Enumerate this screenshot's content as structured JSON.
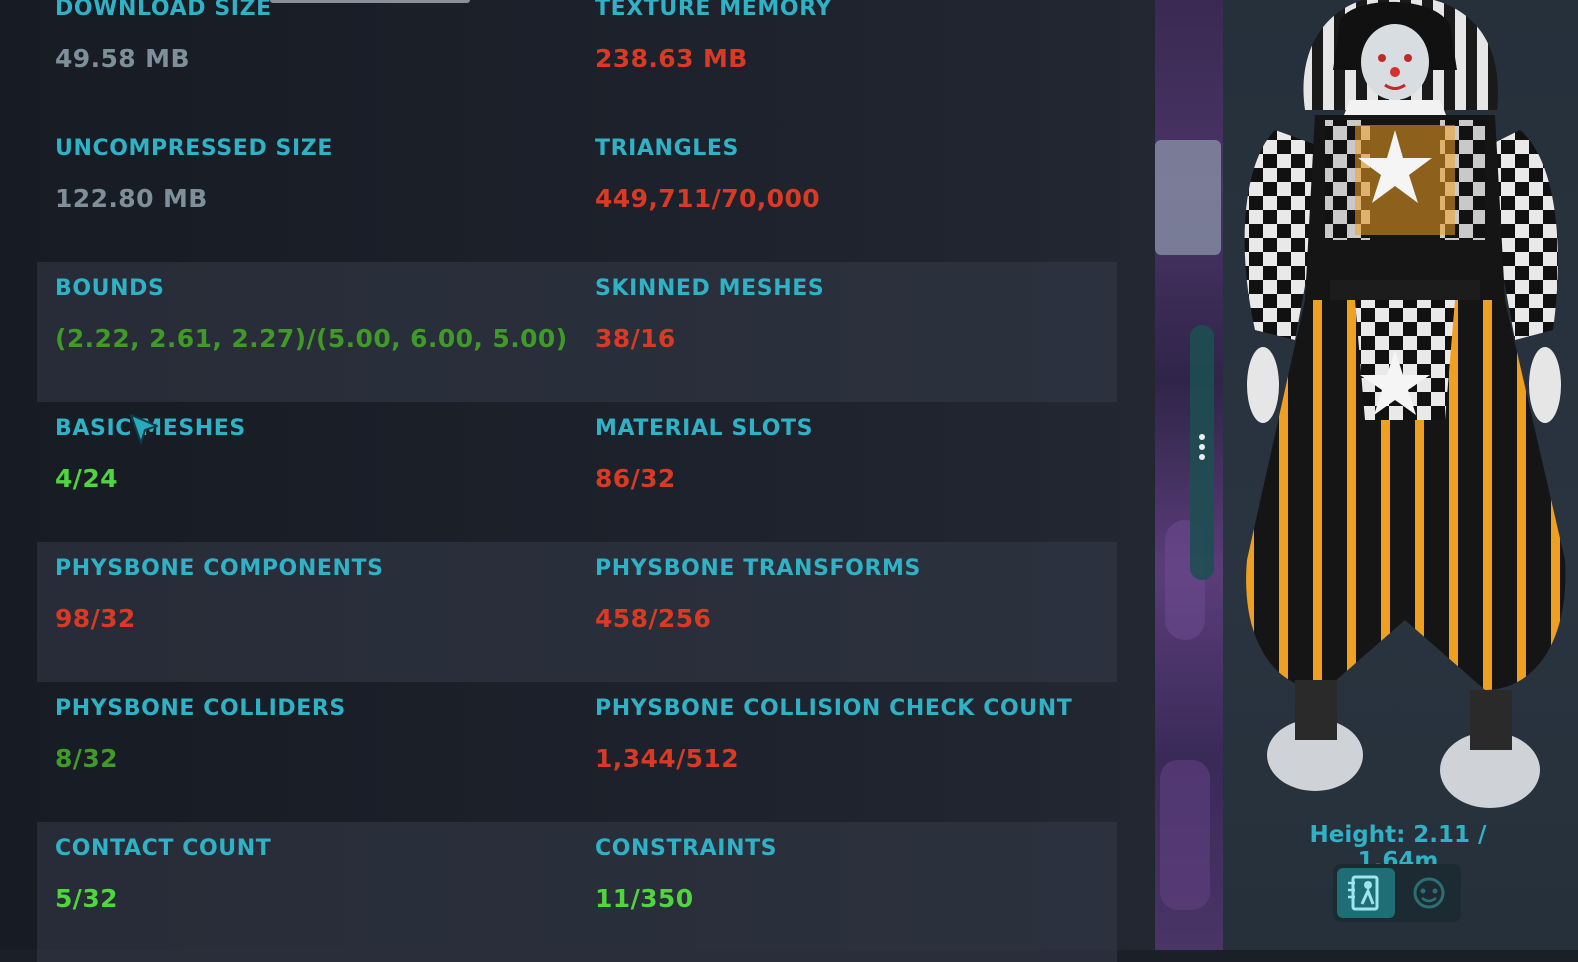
{
  "stats": [
    {
      "left": {
        "label": "DOWNLOAD SIZE",
        "value": "49.58 MB",
        "color": "#7e8f99"
      },
      "right": {
        "label": "TEXTURE MEMORY",
        "value": "238.63 MB",
        "color": "#d93a23"
      }
    },
    {
      "left": {
        "label": "UNCOMPRESSED SIZE",
        "value": "122.80 MB",
        "color": "#7e8f99"
      },
      "right": {
        "label": "TRIANGLES",
        "value": "449,711/70,000",
        "color": "#d93a23"
      }
    },
    {
      "left": {
        "label": "BOUNDS",
        "value": "(2.22, 2.61, 2.27)/(5.00, 6.00, 5.00)",
        "color": "#3f9a28"
      },
      "right": {
        "label": "SKINNED MESHES",
        "value": "38/16",
        "color": "#d93a23"
      }
    },
    {
      "left": {
        "label": "BASIC MESHES",
        "value": "4/24",
        "color": "#4fd53d"
      },
      "right": {
        "label": "MATERIAL SLOTS",
        "value": "86/32",
        "color": "#d93a23"
      }
    },
    {
      "left": {
        "label": "PHYSBONE COMPONENTS",
        "value": "98/32",
        "color": "#d93a23"
      },
      "right": {
        "label": "PHYSBONE TRANSFORMS",
        "value": "458/256",
        "color": "#d93a23"
      }
    },
    {
      "left": {
        "label": "PHYSBONE COLLIDERS",
        "value": "8/32",
        "color": "#3f9a28"
      },
      "right": {
        "label": "PHYSBONE COLLISION CHECK COUNT",
        "value": "1,344/512",
        "color": "#d93a23"
      }
    },
    {
      "left": {
        "label": "CONTACT COUNT",
        "value": "5/32",
        "color": "#4fd53d"
      },
      "right": {
        "label": "CONSTRAINTS",
        "value": "11/350",
        "color": "#4fd53d"
      }
    }
  ],
  "preview": {
    "height_text": "Height: 2.11 / 1.64m",
    "buttons": [
      {
        "icon": "full-body-view-icon",
        "active": true
      },
      {
        "icon": "face-view-icon",
        "active": false
      }
    ]
  },
  "colors": {
    "label": "#2fb2c6",
    "bad": "#d93a23",
    "ok": "#3f9a28",
    "good": "#4fd53d",
    "neutral": "#7e8f99",
    "accent": "#1f6e75"
  }
}
